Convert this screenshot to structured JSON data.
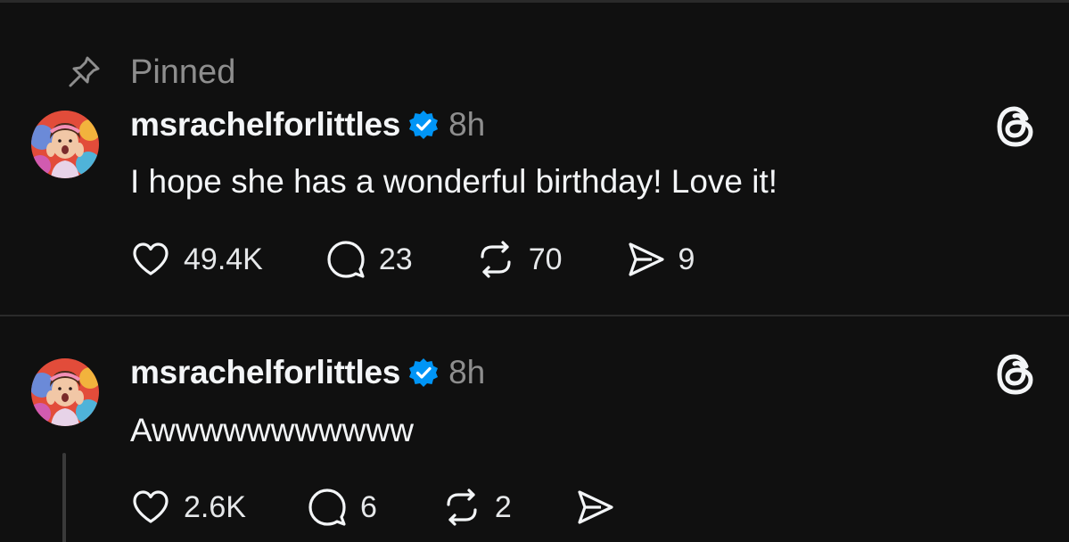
{
  "pinned_label": "Pinned",
  "posts": [
    {
      "username": "msrachelforlittles",
      "time": "8h",
      "text": "I hope she has a wonderful birthday! Love it!",
      "likes": "49.4K",
      "replies": "23",
      "reposts": "70",
      "shares": "9"
    },
    {
      "username": "msrachelforlittles",
      "time": "8h",
      "text": "Awwwwwwwwwww",
      "likes": "2.6K",
      "replies": "6",
      "reposts": "2",
      "shares": ""
    }
  ],
  "colors": {
    "background": "#101010",
    "text_primary": "#f3f5f7",
    "text_secondary": "#8e8e8e",
    "verified_blue": "#0095f6"
  },
  "icons": [
    "pin-icon",
    "verified-badge-icon",
    "threads-logo-icon",
    "heart-icon",
    "comment-icon",
    "repost-icon",
    "share-icon"
  ]
}
